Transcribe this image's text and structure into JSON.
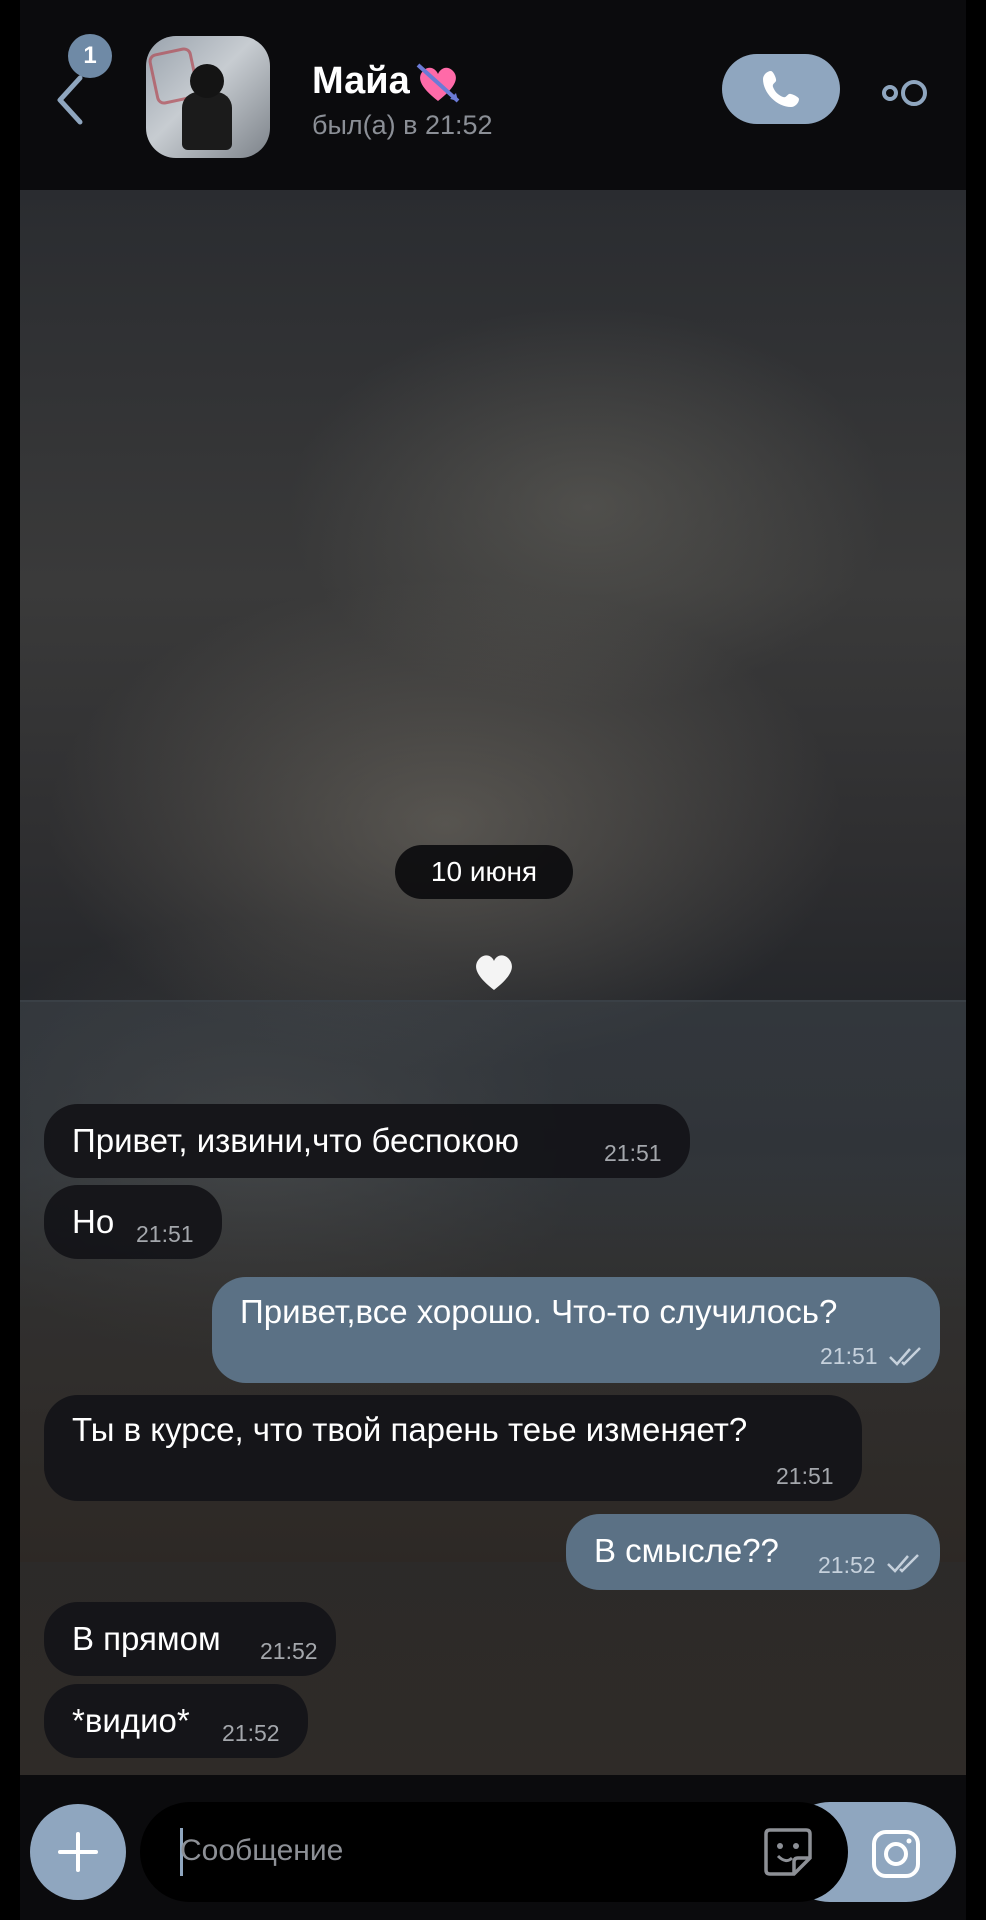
{
  "header": {
    "unread_count": "1",
    "contact_name": "Майа",
    "last_seen": "был(а) в 21:52"
  },
  "chat": {
    "date_label": "10 июня",
    "messages": [
      {
        "direction": "incoming",
        "text": "Привет, извини,что беспокою",
        "time": "21:51"
      },
      {
        "direction": "incoming",
        "text": "Но",
        "time": "21:51"
      },
      {
        "direction": "outgoing",
        "text": "Привет,все хорошо. Что-то случилось?",
        "time": "21:51",
        "read": true
      },
      {
        "direction": "incoming",
        "text": "Ты в курсе, что твой парень теье изменяет?",
        "time": "21:51"
      },
      {
        "direction": "outgoing",
        "text": "В смысле??",
        "time": "21:52",
        "read": true
      },
      {
        "direction": "incoming",
        "text": "В прямом",
        "time": "21:52"
      },
      {
        "direction": "incoming",
        "text": "*видио*",
        "time": "21:52"
      }
    ]
  },
  "composer": {
    "placeholder": "Сообщение"
  },
  "icons": {
    "back": "chevron-left-icon",
    "call": "phone-icon",
    "more": "more-dots-icon",
    "name_emoji": "heart-arrow-emoji",
    "wallpaper_heart": "white-heart-emoji",
    "attach": "plus-icon",
    "sticker": "sticker-icon",
    "camera": "camera-icon",
    "read_receipt": "double-check-icon"
  },
  "colors": {
    "accent": "#8fa6bf",
    "outgoing_bubble": "#5b7185",
    "incoming_bubble": "#141418",
    "header_bg": "#0b0b0d"
  }
}
